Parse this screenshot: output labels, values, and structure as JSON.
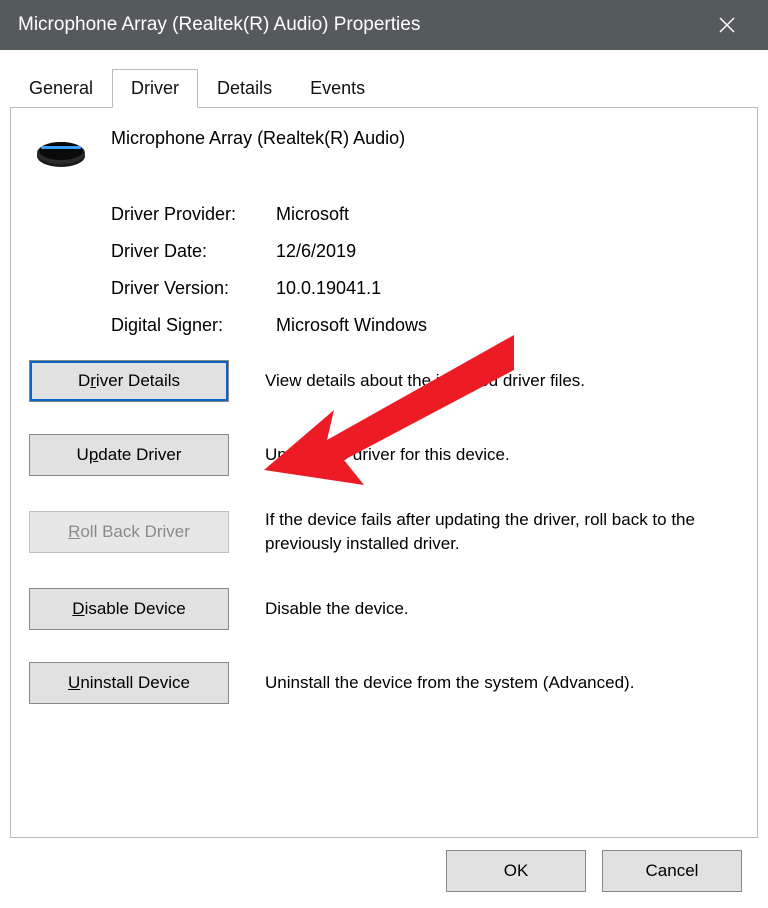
{
  "window": {
    "title": "Microphone Array (Realtek(R) Audio) Properties"
  },
  "tabs": {
    "general": "General",
    "driver": "Driver",
    "details": "Details",
    "events": "Events",
    "active": "driver"
  },
  "device": {
    "name": "Microphone Array (Realtek(R) Audio)"
  },
  "info": {
    "provider_label": "Driver Provider:",
    "provider_value": "Microsoft",
    "date_label": "Driver Date:",
    "date_value": "12/6/2019",
    "version_label": "Driver Version:",
    "version_value": "10.0.19041.1",
    "signer_label": "Digital Signer:",
    "signer_value": "Microsoft Windows"
  },
  "actions": {
    "details_label_pre": "D",
    "details_label_u": "r",
    "details_label_post": "iver Details",
    "details_desc": "View details about the installed driver files.",
    "update_label_pre": "U",
    "update_label_u": "p",
    "update_label_post": "date Driver",
    "update_desc": "Update the driver for this device.",
    "rollback_label_pre": "",
    "rollback_label_u": "R",
    "rollback_label_post": "oll Back Driver",
    "rollback_desc": "If the device fails after updating the driver, roll back to the previously installed driver.",
    "disable_label_pre": "",
    "disable_label_u": "D",
    "disable_label_post": "isable Device",
    "disable_desc": "Disable the device.",
    "uninstall_label_pre": "",
    "uninstall_label_u": "U",
    "uninstall_label_post": "ninstall Device",
    "uninstall_desc": "Uninstall the device from the system (Advanced)."
  },
  "buttons": {
    "ok": "OK",
    "cancel": "Cancel"
  }
}
